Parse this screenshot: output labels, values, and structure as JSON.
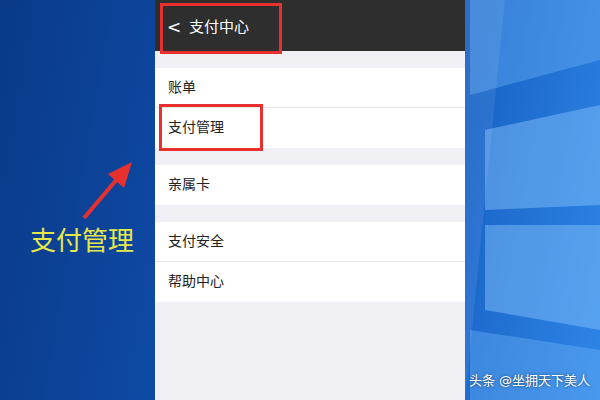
{
  "annotation": {
    "label": "支付管理"
  },
  "phone": {
    "title": {
      "back": "<",
      "text": "支付中心",
      "highlighted": true
    },
    "groups": [
      {
        "items": [
          {
            "label": "账单",
            "highlighted": false
          },
          {
            "label": "支付管理",
            "highlighted": true
          }
        ]
      },
      {
        "items": [
          {
            "label": "亲属卡",
            "highlighted": false
          }
        ]
      },
      {
        "items": [
          {
            "label": "支付安全",
            "highlighted": false
          },
          {
            "label": "帮助中心",
            "highlighted": false
          }
        ]
      }
    ]
  },
  "watermark": "头条 @坐拥天下美人"
}
